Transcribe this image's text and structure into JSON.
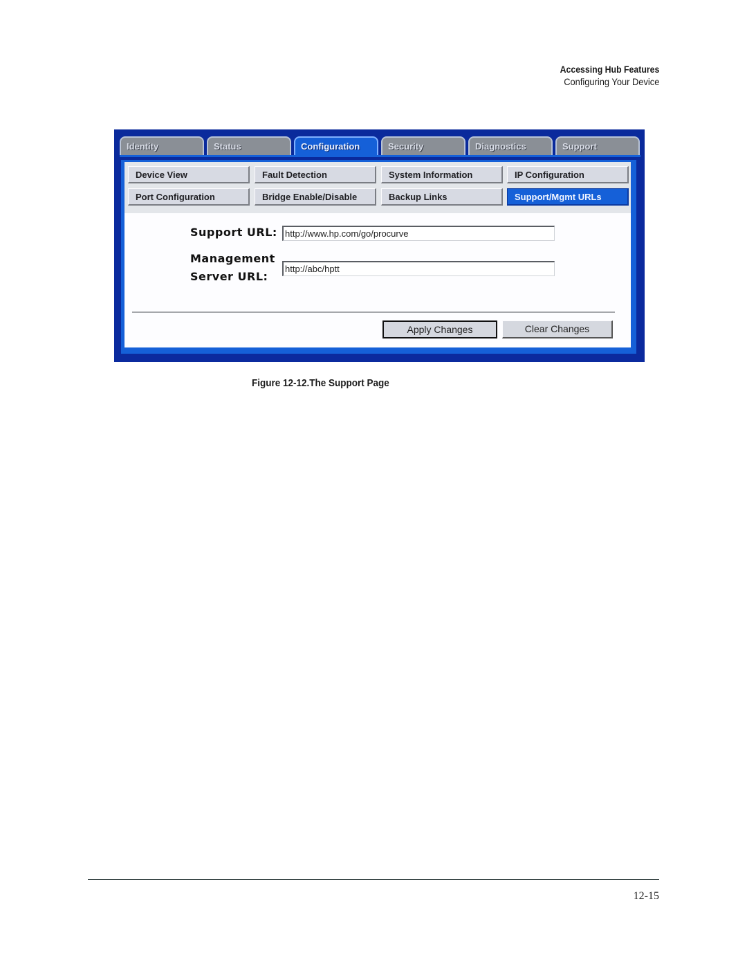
{
  "running_head": {
    "chapter": "Accessing Hub Features",
    "section": "Configuring Your Device"
  },
  "screenshot": {
    "tabs": [
      {
        "label": "Identity",
        "active": false
      },
      {
        "label": "Status",
        "active": false
      },
      {
        "label": "Configuration",
        "active": true
      },
      {
        "label": "Security",
        "active": false
      },
      {
        "label": "Diagnostics",
        "active": false
      },
      {
        "label": "Support",
        "active": false
      }
    ],
    "subnav": [
      {
        "label": "Device View",
        "active": false
      },
      {
        "label": "Fault Detection",
        "active": false
      },
      {
        "label": "System Information",
        "active": false
      },
      {
        "label": "IP Configuration",
        "active": false
      },
      {
        "label": "Port Configuration",
        "active": false
      },
      {
        "label": "Bridge Enable/Disable",
        "active": false
      },
      {
        "label": "Backup Links",
        "active": false
      },
      {
        "label": "Support/Mgmt URLs",
        "active": true
      }
    ],
    "form": {
      "support_url_label": "Support URL:",
      "support_url_value": "http://www.hp.com/go/procurve",
      "mgmt_label_line1": "Management",
      "mgmt_label_line2": "Server URL:",
      "mgmt_url_value": "http://abc/hptt"
    },
    "buttons": {
      "apply": "Apply Changes",
      "clear": "Clear Changes"
    },
    "colors": {
      "frame": "#0b2a9e",
      "accent": "#1560d8",
      "tab_inactive": "#8a8f96",
      "button_face": "#d7dae3"
    }
  },
  "caption": "Figure 12-12.The Support Page",
  "page_number": "12-15"
}
